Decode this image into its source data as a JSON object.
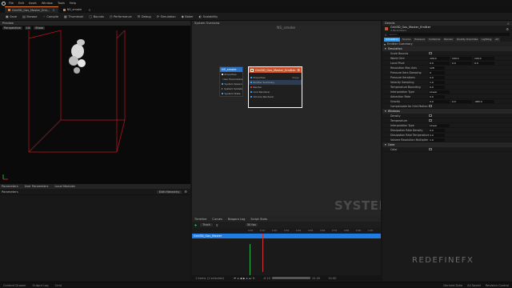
{
  "menu": {
    "items": [
      "File",
      "Edit",
      "Asset",
      "Window",
      "Tools",
      "Help"
    ]
  },
  "tabs": [
    {
      "label": "Grid3D_Gas_Master_Emi..."
    },
    {
      "label": "NS_smoke"
    }
  ],
  "toolbar": {
    "buttons": [
      "Save",
      "Browse",
      "Compile",
      "Thumbnail",
      "Bounds",
      "Performance",
      "Debug",
      "Simulation",
      "Baker",
      "Scalability"
    ]
  },
  "preview": {
    "tab": "Preview",
    "view_mode": "Perspective",
    "lit_mode": "Lit",
    "show_label": "Show"
  },
  "params": {
    "tabs": [
      "Parameters",
      "User Parameters",
      "Local Modules"
    ],
    "row_label": "Parameters",
    "hierarchy_button": "Edit Hierarchy"
  },
  "graph": {
    "tab": "System Overview",
    "title": "NS_smoke",
    "watermark": "SYSTEM",
    "system_node": {
      "title": "NS_smoke",
      "rows": [
        "Properties",
        "User Parameters",
        "System Spawn",
        "System Update",
        "System State"
      ]
    },
    "emitter_node": {
      "title": "Grid3D_Gas_Master_Emitter",
      "rows": [
        "Properties",
        "Emitter Summary",
        "Render",
        "Grid Renderer",
        "Volume Renderer"
      ],
      "stage_label": "Stage"
    }
  },
  "timeline": {
    "tabs": [
      "Timeline",
      "Curves",
      "Niagara Log",
      "Script Stats"
    ],
    "fps": "30 fps",
    "track_label": "Track",
    "emitter_track": "Grid3D_Gas_Master",
    "playhead": "0.00",
    "ruler": [
      "0.00",
      "0.10",
      "0.20",
      "0.30",
      "0.40",
      "0.50",
      "0.60",
      "0.70",
      "0.80",
      "0.90",
      "1.00"
    ],
    "item_count": "1 items (1 selected)",
    "range_start": "0.00",
    "range_end": "10.00",
    "range_left": "-0.10",
    "range_right": "10.00"
  },
  "details": {
    "tab": "Details",
    "header_title": "Grid3D_Gas_Master_Emitter",
    "header_sub": "4 Parameters",
    "search_placeholder": "Search",
    "filter_tabs": [
      "Simulation",
      "Source",
      "Pressure",
      "Collisions",
      "Render",
      "Quality Overrides",
      "Lighting",
      "Ad"
    ],
    "summary_label": "Emitter Summary",
    "sections": [
      {
        "name": "Simulation",
        "rows": [
          {
            "name": "Scale Bounds",
            "type": "check"
          },
          {
            "name": "World Grid",
            "values": [
              "100.0",
              "100.0",
              "100.0"
            ]
          },
          {
            "name": "Local Pivot",
            "values": [
              "0.0",
              "0.0",
              "0.0"
            ]
          },
          {
            "name": "Resolution Max Axis",
            "values": [
              "128"
            ]
          },
          {
            "name": "Pressure Iters Damping",
            "values": [
              "0"
            ]
          },
          {
            "name": "Pressure Iterations",
            "values": [
              "0.0"
            ]
          },
          {
            "name": "Velocity Sampling",
            "values": [
              "1.0"
            ]
          },
          {
            "name": "Temperature Bounding",
            "values": [
              "0.0"
            ]
          },
          {
            "name": "Interpolation Type",
            "values": [
              "Linear"
            ]
          },
          {
            "name": "Advection Rate",
            "values": [
              "0.0"
            ]
          },
          {
            "name": "Gravity",
            "values": [
              "0.0",
              "0.0",
              "-980.0"
            ]
          },
          {
            "name": "Compensate for Grid Motion",
            "type": "check"
          }
        ]
      },
      {
        "name": "Windows",
        "rows": [
          {
            "name": "Density",
            "type": "check"
          },
          {
            "name": "Temperature",
            "type": "check"
          },
          {
            "name": "Interpolation Type",
            "values": [
              "Linear"
            ]
          },
          {
            "name": "Dissipation Rate Density",
            "values": [
              "0.0"
            ]
          },
          {
            "name": "Dissipation Rate Temperature",
            "values": [
              "0.0"
            ]
          },
          {
            "name": "Volume Resolution Multiplier",
            "values": [
              "1.0"
            ]
          }
        ]
      },
      {
        "name": "Color",
        "rows": [
          {
            "name": "Color",
            "type": "check"
          }
        ]
      }
    ]
  },
  "status": {
    "items": [
      "Content Drawer",
      "Output Log",
      "Cmd"
    ],
    "right": [
      "Derived Data",
      "All Saved",
      "Revision Control"
    ]
  },
  "brand": "REDEFINEFX",
  "colors": {
    "accent": "#2a9dff",
    "emitter_node": "#c7512a",
    "bounds": "#c0141e",
    "track": "#1f7ee6",
    "green": "#2bb24c"
  }
}
